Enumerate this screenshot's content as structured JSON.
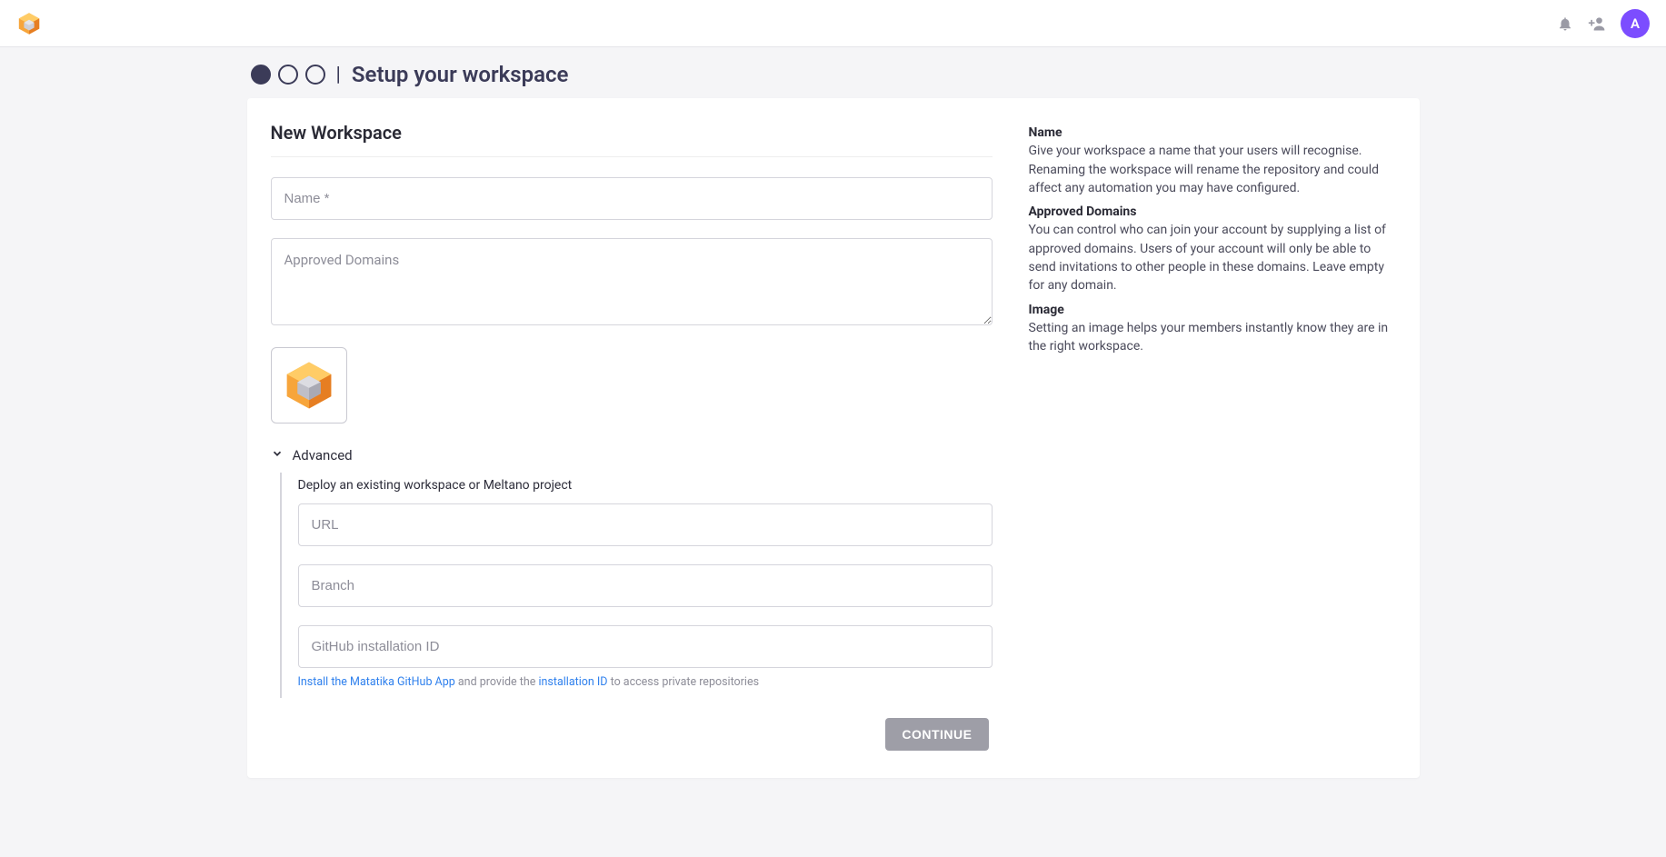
{
  "header": {
    "title": "Setup your workspace",
    "avatar_initial": "A"
  },
  "form": {
    "section_title": "New Workspace",
    "name_placeholder": "Name *",
    "domains_placeholder": "Approved Domains",
    "advanced_label": "Advanced",
    "advanced_caption": "Deploy an existing workspace or Meltano project",
    "url_placeholder": "URL",
    "branch_placeholder": "Branch",
    "gh_install_placeholder": "GitHub installation ID",
    "helper_link1": "Install the Matatika GitHub App",
    "helper_mid": " and provide the ",
    "helper_link2": "installation ID",
    "helper_tail": " to access private repositories",
    "continue_label": "CONTINUE"
  },
  "info": {
    "name_h": "Name",
    "name_p": "Give your workspace a name that your users will recognise. Renaming the workspace will rename the repository and could affect any automation you may have configured.",
    "domains_h": "Approved Domains",
    "domains_p": "You can control who can join your account by supplying a list of approved domains. Users of your account will only be able to send invitations to other people in these domains. Leave empty for any domain.",
    "image_h": "Image",
    "image_p": "Setting an image helps your members instantly know they are in the right workspace."
  }
}
